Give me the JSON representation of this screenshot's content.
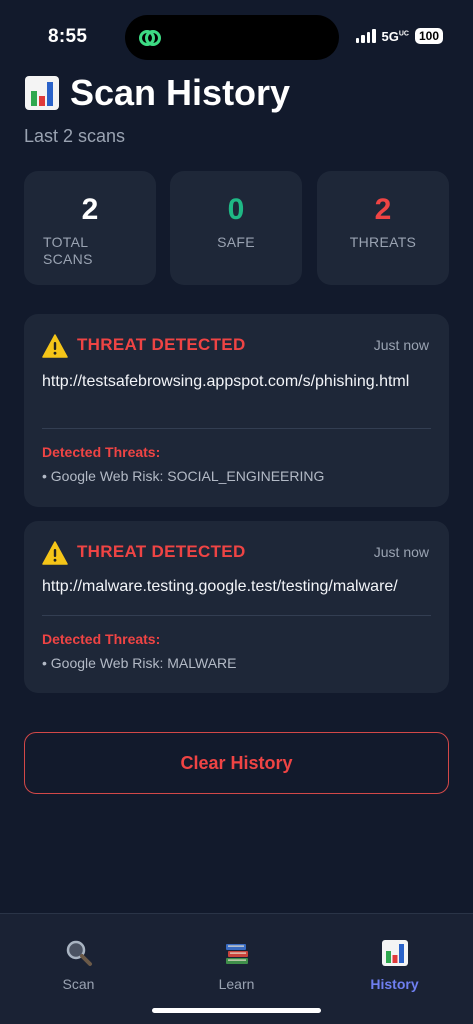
{
  "status_bar": {
    "time": "8:55",
    "network": "5G",
    "network_suffix": "UC",
    "battery": "100"
  },
  "header": {
    "icon": "bar-chart-icon",
    "title": "Scan History",
    "subtitle": "Last 2 scans"
  },
  "stats": [
    {
      "value": "2",
      "label": "TOTAL SCANS",
      "color": "#ffffff"
    },
    {
      "value": "0",
      "label": "SAFE",
      "color": "#1fb885"
    },
    {
      "value": "2",
      "label": "THREATS",
      "color": "#ef4444"
    }
  ],
  "scans": [
    {
      "status": "THREAT DETECTED",
      "time": "Just now",
      "url": "http://testsafebrowsing.appspot.com/s/phishing.html",
      "threats_heading": "Detected Threats:",
      "threats": [
        "• Google Web Risk: SOCIAL_ENGINEERING"
      ]
    },
    {
      "status": "THREAT DETECTED",
      "time": "Just now",
      "url": "http://malware.testing.google.test/testing/malware/",
      "threats_heading": "Detected Threats:",
      "threats": [
        "• Google Web Risk: MALWARE"
      ]
    }
  ],
  "clear_button": {
    "label": "Clear History"
  },
  "tabs": [
    {
      "label": "Scan",
      "icon": "magnifier-icon",
      "active": false
    },
    {
      "label": "Learn",
      "icon": "books-icon",
      "active": false
    },
    {
      "label": "History",
      "icon": "bar-chart-icon",
      "active": true
    }
  ],
  "colors": {
    "background": "#121a2c",
    "card": "#1e2738",
    "danger": "#ef4444",
    "safe": "#1fb885",
    "accent": "#6f7ff0"
  }
}
